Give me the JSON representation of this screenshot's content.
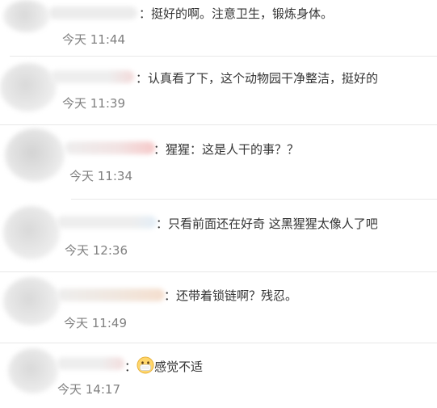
{
  "comments": [
    {
      "text": "挺好的啊。注意卫生，锻炼身体。",
      "time": "今天 11:44"
    },
    {
      "text": "认真看了下，这个动物园干净整洁，挺好的",
      "time": "今天 11:39"
    },
    {
      "text": "猩猩：这是人干的事？？",
      "time": "今天 11:34"
    },
    {
      "text": "只看前面还在好奇 这黑猩猩太像人了吧",
      "time": "今天 12:36"
    },
    {
      "text": "还带着锁链啊？残忍。",
      "time": "今天 11:49"
    },
    {
      "text": "感觉不适",
      "time": "今天 14:17",
      "emoji": "mask-face-emoji"
    }
  ],
  "colon": "："
}
